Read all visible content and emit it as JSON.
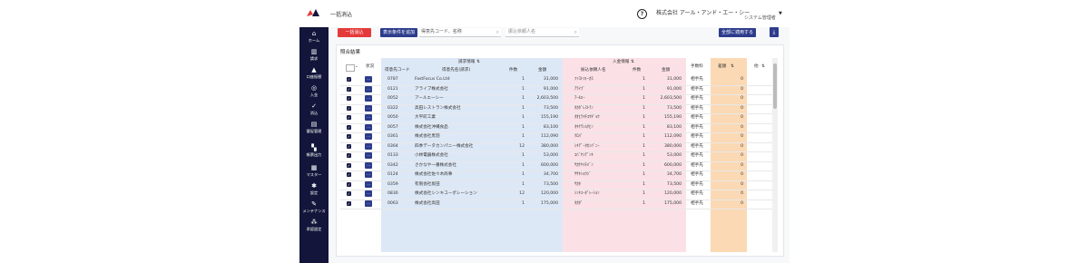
{
  "header": {
    "title": "一括消込",
    "company": "株式会社 アール・アンド・エー・シー",
    "role": "システム管理者"
  },
  "sidebar": [
    {
      "label": "ホーム",
      "icon": "home-icon",
      "glyph": "⌂"
    },
    {
      "label": "請求",
      "icon": "book-icon",
      "glyph": "▥"
    },
    {
      "label": "口座振替",
      "icon": "bank-icon",
      "glyph": "▲"
    },
    {
      "label": "入金",
      "icon": "coin-icon",
      "glyph": "◎"
    },
    {
      "label": "消込",
      "icon": "check-icon",
      "glyph": "✓"
    },
    {
      "label": "督促管理",
      "icon": "document-icon",
      "glyph": "▤"
    },
    {
      "label": "帳票出力",
      "icon": "chart-icon",
      "glyph": "▚"
    },
    {
      "label": "マスター",
      "icon": "database-icon",
      "glyph": "▦"
    },
    {
      "label": "設定",
      "icon": "gear-icon",
      "glyph": "✱"
    },
    {
      "label": "メンテナンス",
      "icon": "wrench-icon",
      "glyph": "✎"
    },
    {
      "label": "承認設定",
      "icon": "network-icon",
      "glyph": "⁂"
    }
  ],
  "toolbar": {
    "bulk_label": "一括消込",
    "filter_label": "表示条件を追加",
    "search1_placeholder": "得意先コード、名称",
    "search2_placeholder": "振込依頼人名",
    "apply_label": "全部に適用する",
    "download_icon": "download-icon"
  },
  "card_title": "照合結果",
  "headers": {
    "select": "",
    "status": "状況",
    "billing_group": "請求情報",
    "billing_code": "得意先コード",
    "billing_name": "得意先名(請求)",
    "billing_count": "件数",
    "billing_amount": "金額",
    "deposit_group": "入金情報",
    "deposit_name": "振込依頼人名",
    "deposit_count": "件数",
    "deposit_amount": "金額",
    "fee": "手数料",
    "diff": "差額",
    "other": "他"
  },
  "rows": [
    {
      "code": "0787",
      "name": "FastFocus Co.Ltd",
      "cnt": "1",
      "amt": "31,000",
      "payer": "ﾌｧｽﾄﾌｫｰｶｽ",
      "dcnt": "1",
      "damt": "31,000",
      "fee": "相手先",
      "diff": "0"
    },
    {
      "code": "0121",
      "name": "アライブ株式会社",
      "cnt": "1",
      "amt": "91,000",
      "payer": "ｱﾗｲﾌﾞ",
      "dcnt": "1",
      "damt": "91,000",
      "fee": "相手先",
      "diff": "0"
    },
    {
      "code": "0052",
      "name": "アールエーシー",
      "cnt": "1",
      "amt": "2,603,500",
      "payer": "ｱｰﾙｴｰ",
      "dcnt": "1",
      "damt": "2,603,500",
      "fee": "相手先",
      "diff": "0"
    },
    {
      "code": "0322",
      "name": "高田レストラン株式会社",
      "cnt": "1",
      "amt": "73,500",
      "payer": "ﾀｶﾀﾞﾚｽﾄﾗﾝ",
      "dcnt": "1",
      "damt": "73,500",
      "fee": "相手先",
      "diff": "0"
    },
    {
      "code": "0050",
      "name": "大平町工業",
      "cnt": "1",
      "amt": "155,190",
      "payer": "ｵｵﾋﾗﾏﾁｺｳｷﾞｮｳ",
      "dcnt": "1",
      "damt": "155,190",
      "fee": "相手先",
      "diff": "0"
    },
    {
      "code": "0057",
      "name": "株式会社沖縄食品",
      "cnt": "1",
      "amt": "83,100",
      "payer": "ｵｷﾅﾜｼｮｸﾋﾝ",
      "dcnt": "1",
      "damt": "83,100",
      "fee": "相手先",
      "diff": "0"
    },
    {
      "code": "0361",
      "name": "株式会社黒羽",
      "cnt": "1",
      "amt": "112,090",
      "payer": "ｸﾛﾊﾞ",
      "dcnt": "1",
      "damt": "112,090",
      "fee": "相手先",
      "diff": "0"
    },
    {
      "code": "0364",
      "name": "四季データカンパニー株式会社",
      "cnt": "12",
      "amt": "380,000",
      "payer": "ｼｷﾃﾞｰﾀｶﾝﾊﾟﾆｰ",
      "dcnt": "1",
      "damt": "380,000",
      "fee": "相手先",
      "diff": "0"
    },
    {
      "code": "0133",
      "name": "小林電器株式会社",
      "cnt": "1",
      "amt": "53,000",
      "payer": "ｺﾊﾞﾔｼﾃﾞﾝｷ",
      "dcnt": "1",
      "damt": "53,000",
      "fee": "相手先",
      "diff": "0"
    },
    {
      "code": "0342",
      "name": "さかなや一番株式会社",
      "cnt": "1",
      "amt": "600,000",
      "payer": "ｻｶﾅﾔｲﾁﾊﾞﾝ",
      "dcnt": "1",
      "damt": "600,000",
      "fee": "相手先",
      "diff": "0"
    },
    {
      "code": "0124",
      "name": "株式会社佐々木商事",
      "cnt": "1",
      "amt": "34,700",
      "payer": "ｻｻｷｼｮｳｼﾞ",
      "dcnt": "1",
      "damt": "34,700",
      "fee": "相手先",
      "diff": "0"
    },
    {
      "code": "0359",
      "name": "有限会社坂田",
      "cnt": "1",
      "amt": "73,500",
      "payer": "ｻｶﾀ",
      "dcnt": "1",
      "damt": "73,500",
      "fee": "相手先",
      "diff": "0"
    },
    {
      "code": "0830",
      "name": "株式会社シンキコーポレーション",
      "cnt": "12",
      "amt": "120,000",
      "payer": "ｼﾝｷｺｰﾎﾟﾚｰｼｮﾝ",
      "dcnt": "1",
      "damt": "120,000",
      "fee": "相手先",
      "diff": "0"
    },
    {
      "code": "0063",
      "name": "株式会社高田",
      "cnt": "1",
      "amt": "175,000",
      "payer": "ﾀｶﾀﾞ",
      "dcnt": "1",
      "damt": "175,000",
      "fee": "相手先",
      "diff": "0"
    }
  ],
  "colors": {
    "sidebar": "#13163a",
    "accent_red": "#e53a3a",
    "accent_navy": "#2d3c8c",
    "billing_bg": "#dde8f7",
    "deposit_bg": "#fbe1e6",
    "diff_bg": "#fbd9b4"
  }
}
